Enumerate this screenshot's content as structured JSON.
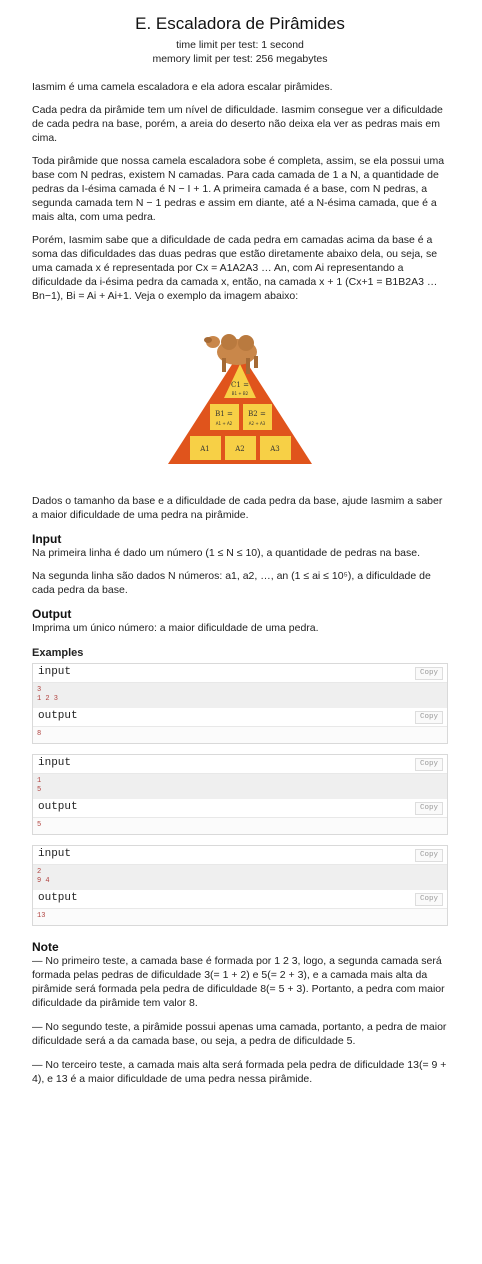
{
  "problem": {
    "title": "E. Escaladora de Pirâmides",
    "time_limit": "time limit per test: 1 second",
    "memory_limit": "memory limit per test: 256 megabytes"
  },
  "statement": {
    "p1": "Iasmim é uma camela escaladora e ela adora escalar pirâmides.",
    "p2": "Cada pedra da pirâmide tem um nível de dificuldade. Iasmim consegue ver a dificuldade de cada pedra na base, porém, a areia do deserto não deixa ela ver as pedras mais em cima.",
    "p3": "Toda pirâmide que nossa camela escaladora sobe é completa, assim, se ela possui uma base com N pedras, existem N camadas. Para cada camada de 1 a N, a quantidade de pedras da I-ésima camada é N − I + 1. A primeira camada é a base, com N pedras, a segunda camada tem N − 1 pedras e assim em diante, até a N-ésima camada, que é a mais alta, com uma pedra.",
    "p4": "Porém, Iasmim sabe que a dificuldade de cada pedra em camadas acima da base é a soma das dificuldades das duas pedras que estão diretamente abaixo dela, ou seja, se uma camada x é representada por Cx = A1A2A3 … An, com Ai representando a dificuldade da i-ésima pedra da camada x, então, na camada x + 1 (Cx+1 = B1B2A3 … Bn−1), Bi = Ai + Ai+1. Veja o exemplo da imagem abaixo:",
    "p5": "Dados o tamanho da base e a dificuldade de cada pedra da base, ajude Iasmim a saber a maior dificuldade de uma pedra na pirâmide."
  },
  "figure": {
    "top_label": "C1 =",
    "top_sub": "B1 + B2",
    "mid_left": "B1 =",
    "mid_left_sub": "A1 + A2",
    "mid_right": "B2 =",
    "mid_right_sub": "A2 + A3",
    "base": [
      "A1",
      "A2",
      "A3"
    ],
    "colors": {
      "stone": "#f7d046",
      "frame": "#e0541c",
      "camel": "#c9874a"
    }
  },
  "input_section": {
    "heading": "Input",
    "p1": "Na primeira linha é dado um número (1 ≤ N ≤ 10), a quantidade de pedras na base.",
    "p2": "Na segunda linha são dados N números: a1, a2, …, an (1 ≤ ai ≤ 10⁵), a dificuldade de cada pedra da base."
  },
  "output_section": {
    "heading": "Output",
    "p1": "Imprima um único número: a maior dificuldade de uma pedra."
  },
  "examples": {
    "heading": "Examples",
    "input_label": "input",
    "output_label": "output",
    "copy_label": "Copy",
    "items": [
      {
        "input": [
          "3",
          "1 2 3"
        ],
        "output": [
          "8"
        ]
      },
      {
        "input": [
          "1",
          "5"
        ],
        "output": [
          "5"
        ]
      },
      {
        "input": [
          "2",
          "9 4"
        ],
        "output": [
          "13"
        ]
      }
    ]
  },
  "note": {
    "heading": "Note",
    "p1": "— No primeiro teste, a camada base é formada por 1 2 3, logo, a segunda camada será formada pelas pedras de dificuldade 3(= 1 + 2) e 5(= 2 + 3), e a camada mais alta da pirâmide será formada pela pedra de dificuldade 8(= 5 + 3). Portanto, a pedra com maior dificuldade da pirâmide tem valor 8.",
    "p2": "— No segundo teste, a pirâmide possui apenas uma camada, portanto, a pedra de maior dificuldade será a da camada base, ou seja, a pedra de dificuldade 5.",
    "p3": "— No terceiro teste, a camada mais alta será formada pela pedra de dificuldade 13(= 9 + 4), e 13 é a maior dificuldade de uma pedra nessa pirâmide."
  }
}
